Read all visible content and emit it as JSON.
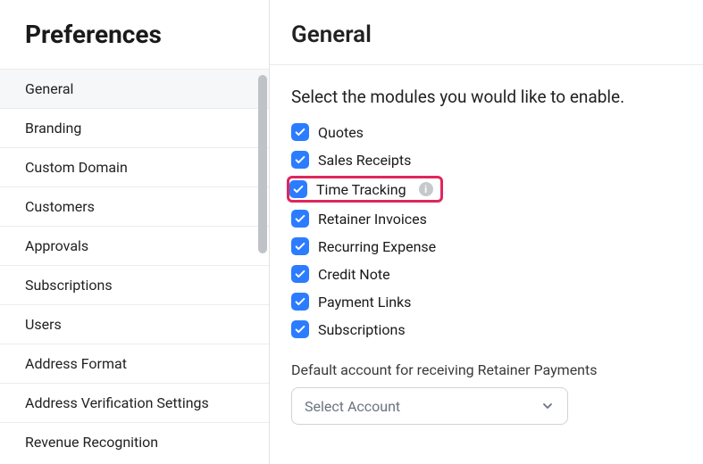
{
  "sidebar": {
    "title": "Preferences",
    "items": [
      {
        "label": "General",
        "active": true
      },
      {
        "label": "Branding"
      },
      {
        "label": "Custom Domain"
      },
      {
        "label": "Customers"
      },
      {
        "label": "Approvals"
      },
      {
        "label": "Subscriptions"
      },
      {
        "label": "Users"
      },
      {
        "label": "Address Format"
      },
      {
        "label": "Address Verification Settings"
      },
      {
        "label": "Revenue Recognition"
      }
    ]
  },
  "main": {
    "title": "General",
    "section_heading": "Select the modules you would like to enable.",
    "modules": [
      {
        "label": "Quotes",
        "checked": true
      },
      {
        "label": "Sales Receipts",
        "checked": true
      },
      {
        "label": "Time Tracking",
        "checked": true,
        "info": true,
        "highlight": true
      },
      {
        "label": "Retainer Invoices",
        "checked": true
      },
      {
        "label": "Recurring Expense",
        "checked": true
      },
      {
        "label": "Credit Note",
        "checked": true
      },
      {
        "label": "Payment Links",
        "checked": true
      },
      {
        "label": "Subscriptions",
        "checked": true
      }
    ],
    "default_account": {
      "label": "Default account for receiving Retainer Payments",
      "placeholder": "Select Account"
    }
  }
}
